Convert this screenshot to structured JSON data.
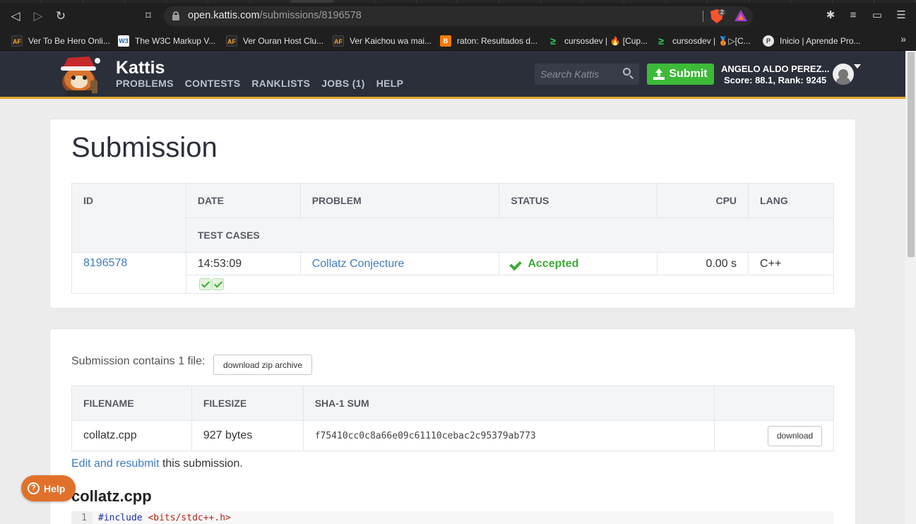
{
  "browser": {
    "url_host": "open.kattis.com",
    "url_path": "/submissions/8196578",
    "shield_count": "2"
  },
  "bookmarks": [
    {
      "icon": "AF",
      "label": "Ver To Be Hero Onli..."
    },
    {
      "icon": "W3",
      "label": "The W3C Markup V..."
    },
    {
      "icon": "AF",
      "label": "Ver Ouran Host Clu..."
    },
    {
      "icon": "AF",
      "label": "Ver Kaichou wa mai..."
    },
    {
      "icon": "B",
      "label": "raton: Resultados d..."
    },
    {
      "icon": "≥",
      "label": "cursosdev | 🔥 [Cup..."
    },
    {
      "icon": "≥",
      "label": "cursosdev | 🥉▷[C..."
    },
    {
      "icon": "P",
      "label": "Inicio | Aprende Pro..."
    }
  ],
  "header": {
    "brand": "Kattis",
    "nav": [
      "PROBLEMS",
      "CONTESTS",
      "RANKLISTS",
      "JOBS (1)",
      "HELP"
    ],
    "search_placeholder": "Search Kattis",
    "submit_label": "Submit",
    "user_name": "ANGELO ALDO PEREZ...",
    "user_score": "Score: 88.1, Rank: 9245"
  },
  "submission": {
    "title": "Submission",
    "headers": {
      "id": "ID",
      "date": "DATE",
      "problem": "PROBLEM",
      "status": "STATUS",
      "cpu": "CPU",
      "lang": "LANG",
      "test_cases": "TEST CASES"
    },
    "row": {
      "id": "8196578",
      "date": "14:53:09",
      "problem": "Collatz Conjecture",
      "status": "Accepted",
      "cpu": "0.00 s",
      "lang": "C++"
    },
    "test_cases_passed": 2
  },
  "files": {
    "contains_text": "Submission contains 1 file:",
    "zip_button": "download zip archive",
    "headers": {
      "filename": "FILENAME",
      "filesize": "FILESIZE",
      "sha": "SHA-1 SUM"
    },
    "row": {
      "filename": "collatz.cpp",
      "filesize": "927 bytes",
      "sha": "f75410cc0c8a66e09c61110cebac2c95379ab773",
      "download": "download"
    },
    "edit_link": "Edit and resubmit",
    "edit_suffix": " this submission.",
    "file_heading": "collatz.cpp",
    "code": {
      "line_no": "1",
      "keyword": "#include",
      "header": "<bits/stdc++.h>"
    }
  },
  "help_widget": {
    "label": "Help",
    "icon_glyph": "?"
  },
  "colors": {
    "accepted": "#3cab37",
    "submit": "#3cba38",
    "header_bg": "#2b2f3a",
    "header_accent": "#e3a82b",
    "link": "#3d7cc1",
    "help": "#e1712a"
  }
}
